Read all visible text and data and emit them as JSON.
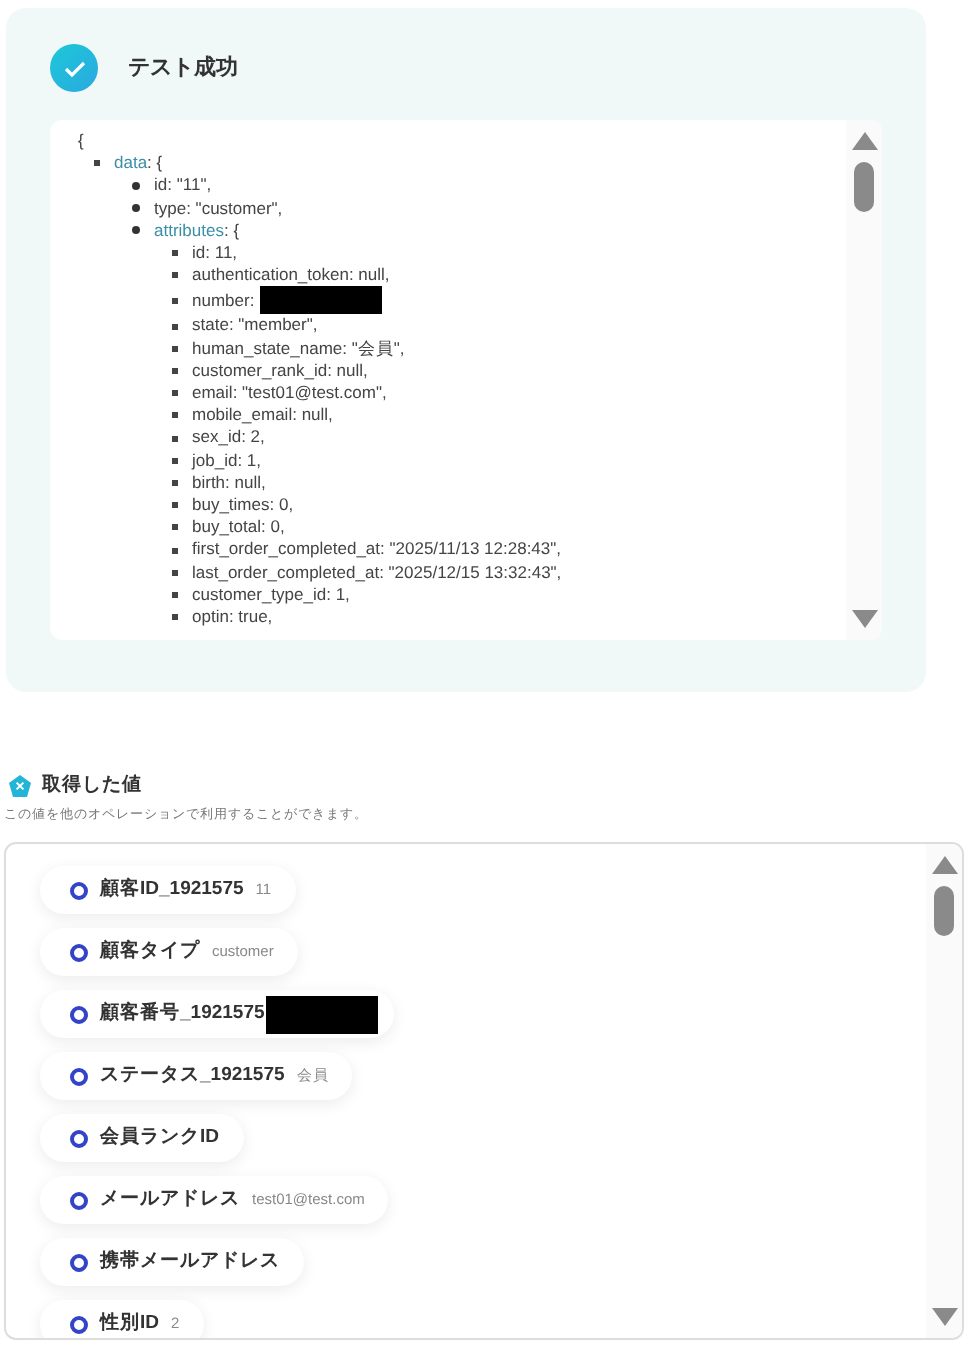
{
  "test_result": {
    "title": "テスト成功",
    "json_view": {
      "open": "{",
      "nodes": [
        {
          "key": "data",
          "value": ": {",
          "kind": "object",
          "children": [
            {
              "key": "id",
              "value": ": \"11\","
            },
            {
              "key": "type",
              "value": ": \"customer\","
            },
            {
              "key": "attributes",
              "value": ": {",
              "kind": "object",
              "children": [
                {
                  "key": "id",
                  "value": ": 11,"
                },
                {
                  "key": "authentication_token",
                  "value": ": null,"
                },
                {
                  "key": "number",
                  "value": ":",
                  "redacted": true
                },
                {
                  "key": "state",
                  "value": ": \"member\","
                },
                {
                  "key": "human_state_name",
                  "value": ": \"会員\","
                },
                {
                  "key": "customer_rank_id",
                  "value": ": null,"
                },
                {
                  "key": "email",
                  "value": ": \"test01@test.com\","
                },
                {
                  "key": "mobile_email",
                  "value": ": null,"
                },
                {
                  "key": "sex_id",
                  "value": ": 2,"
                },
                {
                  "key": "job_id",
                  "value": ": 1,"
                },
                {
                  "key": "birth",
                  "value": ": null,"
                },
                {
                  "key": "buy_times",
                  "value": ": 0,"
                },
                {
                  "key": "buy_total",
                  "value": ": 0,"
                },
                {
                  "key": "first_order_completed_at",
                  "value": ": \"2025/11/13 12:28:43\","
                },
                {
                  "key": "last_order_completed_at",
                  "value": ": \"2025/12/15 13:32:43\","
                },
                {
                  "key": "customer_type_id",
                  "value": ": 1,"
                },
                {
                  "key": "optin",
                  "value": ": true,"
                }
              ]
            }
          ]
        }
      ]
    }
  },
  "values": {
    "title": "取得した値",
    "description": "この値を他のオペレーションで利用することができます。",
    "items": [
      {
        "label": "顧客ID_1921575",
        "value": "11"
      },
      {
        "label": "顧客タイプ",
        "value": "customer"
      },
      {
        "label": "顧客番号_1921575",
        "redacted": true
      },
      {
        "label": "ステータス_1921575",
        "value": "会員"
      },
      {
        "label": "会員ランクID"
      },
      {
        "label": "メールアドレス",
        "value": "test01@test.com"
      },
      {
        "label": "携帯メールアドレス"
      },
      {
        "label": "性別ID",
        "value": "2"
      }
    ]
  }
}
